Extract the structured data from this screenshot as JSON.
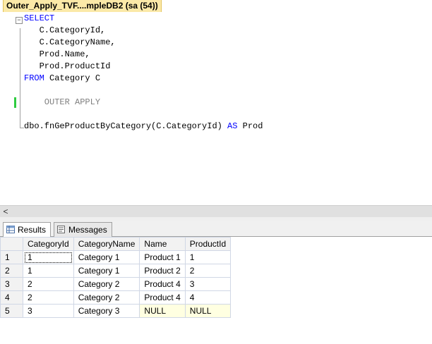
{
  "window": {
    "tab_title": "Outer_Apply_TVF....mpleDB2 (sa (54))"
  },
  "editor": {
    "lines": [
      {
        "parts": [
          {
            "t": "SELECT",
            "c": "kw"
          }
        ]
      },
      {
        "parts": [
          {
            "t": "   C.CategoryId,",
            "c": ""
          }
        ]
      },
      {
        "parts": [
          {
            "t": "   C.CategoryName,",
            "c": ""
          }
        ]
      },
      {
        "parts": [
          {
            "t": "   Prod.Name,",
            "c": ""
          }
        ]
      },
      {
        "parts": [
          {
            "t": "   Prod.ProductId",
            "c": ""
          }
        ]
      },
      {
        "parts": [
          {
            "t": "FROM",
            "c": "kw"
          },
          {
            "t": " Category C",
            "c": ""
          }
        ]
      },
      {
        "parts": [
          {
            "t": "",
            "c": ""
          }
        ]
      },
      {
        "parts": [
          {
            "t": "    OUTER APPLY",
            "c": "gray"
          }
        ]
      },
      {
        "parts": [
          {
            "t": "",
            "c": ""
          }
        ]
      },
      {
        "parts": [
          {
            "t": "dbo.fnGeProductByCategory(C.CategoryId) ",
            "c": ""
          },
          {
            "t": "AS",
            "c": "kw"
          },
          {
            "t": " Prod",
            "c": ""
          }
        ]
      }
    ]
  },
  "result_tabs": [
    {
      "label": "Results",
      "icon": "grid-icon",
      "active": true
    },
    {
      "label": "Messages",
      "icon": "messages-icon",
      "active": false
    }
  ],
  "grid": {
    "columns": [
      "CategoryId",
      "CategoryName",
      "Name",
      "ProductId"
    ],
    "rows": [
      {
        "num": "1",
        "cells": [
          "1",
          "Category 1",
          "Product 1",
          "1"
        ]
      },
      {
        "num": "2",
        "cells": [
          "1",
          "Category 1",
          "Product 2",
          "2"
        ]
      },
      {
        "num": "3",
        "cells": [
          "2",
          "Category 2",
          "Product 4",
          "3"
        ]
      },
      {
        "num": "4",
        "cells": [
          "2",
          "Category 2",
          "Product 4",
          "4"
        ]
      },
      {
        "num": "5",
        "cells": [
          "3",
          "Category 3",
          "NULL",
          "NULL"
        ]
      }
    ]
  },
  "colors": {
    "keyword": "#0000ff",
    "comment_gray": "#808080",
    "null_cell": "#ffffe1",
    "tab_highlight": "#fbe9a8"
  }
}
